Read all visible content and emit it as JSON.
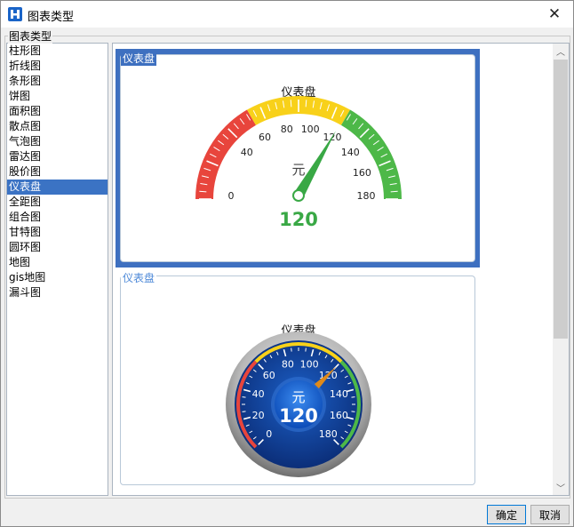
{
  "window": {
    "title": "图表类型",
    "close_glyph": "✕"
  },
  "group": {
    "label": "图表类型"
  },
  "chart_types": [
    {
      "label": "柱形图",
      "selected": false
    },
    {
      "label": "折线图",
      "selected": false
    },
    {
      "label": "条形图",
      "selected": false
    },
    {
      "label": "饼图",
      "selected": false
    },
    {
      "label": "面积图",
      "selected": false
    },
    {
      "label": "散点图",
      "selected": false
    },
    {
      "label": "气泡图",
      "selected": false
    },
    {
      "label": "雷达图",
      "selected": false
    },
    {
      "label": "股价图",
      "selected": false
    },
    {
      "label": "仪表盘",
      "selected": true
    },
    {
      "label": "全距图",
      "selected": false
    },
    {
      "label": "组合图",
      "selected": false
    },
    {
      "label": "甘特图",
      "selected": false
    },
    {
      "label": "圆环图",
      "selected": false
    },
    {
      "label": "地图",
      "selected": false
    },
    {
      "label": "gis地图",
      "selected": false
    },
    {
      "label": "漏斗图",
      "selected": false
    }
  ],
  "previews": [
    {
      "legend": "仪表盘",
      "selected": true,
      "style": "flat",
      "gauge_title": "仪表盘",
      "unit": "元",
      "value": "120",
      "value_num": 120,
      "min": 0,
      "max": 180,
      "ticks": [
        "0",
        "20",
        "40",
        "60",
        "80",
        "100",
        "120",
        "140",
        "160",
        "180"
      ],
      "tick_labels_visible": [
        "0",
        "40",
        "60",
        "80",
        "100",
        "120",
        "140",
        "160",
        "180"
      ],
      "bands": [
        {
          "from": 0,
          "to": 60,
          "color": "#e8453c"
        },
        {
          "from": 60,
          "to": 120,
          "color": "#f8d11a"
        },
        {
          "from": 120,
          "to": 180,
          "color": "#4db848"
        }
      ],
      "needle_color": "#39a845",
      "value_color": "#39a845"
    },
    {
      "legend": "仪表盘",
      "selected": false,
      "style": "dial",
      "gauge_title": "仪表盘",
      "unit": "元",
      "value": "120",
      "value_num": 120,
      "min": 0,
      "max": 180,
      "ticks": [
        "0",
        "20",
        "40",
        "60",
        "80",
        "100",
        "120",
        "140",
        "160",
        "180"
      ],
      "bands": [
        {
          "from": 0,
          "to": 60,
          "color": "#e8453c"
        },
        {
          "from": 60,
          "to": 120,
          "color": "#f8d11a"
        },
        {
          "from": 120,
          "to": 180,
          "color": "#4db848"
        }
      ],
      "needle_color": "#e08a1a",
      "value_color": "#ffffff"
    }
  ],
  "buttons": {
    "ok": "确定",
    "cancel": "取消"
  },
  "colors": {
    "selection": "#3b73c4",
    "card_selected": "#3e70c0",
    "legend": "#4c88d8"
  },
  "icons": {
    "app": "app-logo-icon",
    "close": "close-icon",
    "scroll_up": "chevron-up-icon",
    "scroll_down": "chevron-down-icon"
  }
}
